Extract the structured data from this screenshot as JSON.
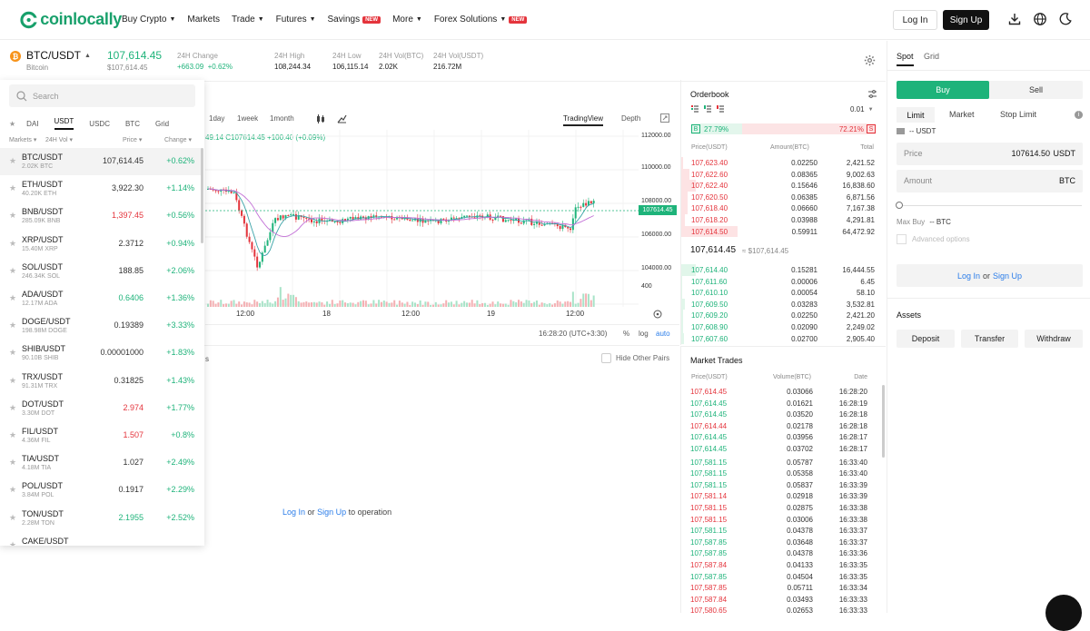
{
  "header": {
    "logo_text": "coinlocally",
    "nav": [
      {
        "label": "Buy Crypto",
        "caret": true,
        "badge": ""
      },
      {
        "label": "Markets",
        "caret": false,
        "badge": ""
      },
      {
        "label": "Trade",
        "caret": true,
        "badge": ""
      },
      {
        "label": "Futures",
        "caret": true,
        "badge": ""
      },
      {
        "label": "Savings",
        "caret": false,
        "badge": "NEW"
      },
      {
        "label": "More",
        "caret": true,
        "badge": ""
      },
      {
        "label": "Forex Solutions",
        "caret": true,
        "badge": "NEW"
      }
    ],
    "login": "Log In",
    "signup": "Sign Up"
  },
  "ticker": {
    "pair": "BTC/USDT",
    "name": "Bitcoin",
    "last_price": "107,614.45",
    "last_price_usd": "$107,614.45",
    "change_label": "24H Change",
    "change_abs": "+663.09",
    "change_pct": "+0.62%",
    "high_label": "24H High",
    "high": "108,244.34",
    "low_label": "24H Low",
    "low": "106,115.14",
    "volbtc_label": "24H Vol(BTC)",
    "volbtc": "2.02K",
    "volusdt_label": "24H Vol(USDT)",
    "volusdt": "216.72M"
  },
  "markets": {
    "search_placeholder": "Search",
    "quote_tabs": [
      "DAI",
      "USDT",
      "USDC",
      "BTC",
      "Grid"
    ],
    "active_tab": "USDT",
    "col_markets": "Markets",
    "col_vol": "24H Vol",
    "col_price": "Price",
    "col_change": "Change",
    "rows": [
      {
        "pair": "BTC/USDT",
        "vol": "2.02K BTC",
        "price": "107,614.45",
        "change": "+0.62%",
        "price_color": "neutral"
      },
      {
        "pair": "ETH/USDT",
        "vol": "40.20K ETH",
        "price": "3,922.30",
        "change": "+1.14%",
        "price_color": "neutral"
      },
      {
        "pair": "BNB/USDT",
        "vol": "285.09K BNB",
        "price": "1,397.45",
        "change": "+0.56%",
        "price_color": "red"
      },
      {
        "pair": "XRP/USDT",
        "vol": "15.40M XRP",
        "price": "2.3712",
        "change": "+0.94%",
        "price_color": "neutral"
      },
      {
        "pair": "SOL/USDT",
        "vol": "246.34K SOL",
        "price": "188.85",
        "change": "+2.06%",
        "price_color": "neutral"
      },
      {
        "pair": "ADA/USDT",
        "vol": "12.17M ADA",
        "price": "0.6406",
        "change": "+1.36%",
        "price_color": "green"
      },
      {
        "pair": "DOGE/USDT",
        "vol": "198.98M DOGE",
        "price": "0.19389",
        "change": "+3.33%",
        "price_color": "neutral"
      },
      {
        "pair": "SHIB/USDT",
        "vol": "90.10B SHIB",
        "price": "0.00001000",
        "change": "+1.83%",
        "price_color": "neutral"
      },
      {
        "pair": "TRX/USDT",
        "vol": "91.31M TRX",
        "price": "0.31825",
        "change": "+1.43%",
        "price_color": "neutral"
      },
      {
        "pair": "DOT/USDT",
        "vol": "3.30M DOT",
        "price": "2.974",
        "change": "+1.77%",
        "price_color": "red"
      },
      {
        "pair": "FIL/USDT",
        "vol": "4.36M FIL",
        "price": "1.507",
        "change": "+0.8%",
        "price_color": "red"
      },
      {
        "pair": "TIA/USDT",
        "vol": "4.18M TIA",
        "price": "1.027",
        "change": "+2.49%",
        "price_color": "neutral"
      },
      {
        "pair": "POL/USDT",
        "vol": "3.84M POL",
        "price": "0.1917",
        "change": "+2.29%",
        "price_color": "neutral"
      },
      {
        "pair": "TON/USDT",
        "vol": "2.28M TON",
        "price": "2.1955",
        "change": "+2.52%",
        "price_color": "green"
      },
      {
        "pair": "CAKE/USDT",
        "vol": "",
        "price": "",
        "change": "",
        "price_color": "neutral"
      }
    ]
  },
  "chart": {
    "intervals": [
      "1day",
      "1week",
      "1month"
    ],
    "view_tabs": [
      "TradingView",
      "Depth"
    ],
    "ohlc_text": "49.14 C107614.45 +100.40 (+0.09%)",
    "price_tag": "107614.45",
    "y_ticks": [
      "112000.00",
      "110000.00",
      "108000.00",
      "106000.00",
      "104000.00",
      "400"
    ],
    "x_ticks": [
      "12:00",
      "18",
      "12:00",
      "19",
      "12:00"
    ],
    "time_display": "16:28:20 (UTC+3:30)",
    "scale_percent": "%",
    "scale_log": "log",
    "scale_auto": "auto",
    "hide_other_pairs": "Hide Other Pairs",
    "login_prompt_login": "Log In",
    "login_prompt_or": "or",
    "login_prompt_signup": "Sign Up",
    "login_prompt_rest": "to operation",
    "truncated_tab_tail": "s"
  },
  "orderbook": {
    "title": "Orderbook",
    "precision": "0.01",
    "buy_pct": "27.79%",
    "sell_pct": "72.21%",
    "buy_letter": "B",
    "sell_letter": "S",
    "col_price": "Price(USDT)",
    "col_amount": "Amount(BTC)",
    "col_total": "Total",
    "asks": [
      {
        "price": "107,623.40",
        "amount": "0.02250",
        "total": "2,421.52",
        "depth": 0.04
      },
      {
        "price": "107,622.60",
        "amount": "0.08365",
        "total": "9,002.63",
        "depth": 0.14
      },
      {
        "price": "107,622.40",
        "amount": "0.15646",
        "total": "16,838.60",
        "depth": 0.26
      },
      {
        "price": "107,620.50",
        "amount": "0.06385",
        "total": "6,871.56",
        "depth": 0.11
      },
      {
        "price": "107,618.40",
        "amount": "0.06660",
        "total": "7,167.38",
        "depth": 0.11
      },
      {
        "price": "107,618.20",
        "amount": "0.03988",
        "total": "4,291.81",
        "depth": 0.07
      },
      {
        "price": "107,614.50",
        "amount": "0.59911",
        "total": "64,472.92",
        "depth": 1.0
      }
    ],
    "mid_price": "107,614.45",
    "mid_usd": "≈ $107,614.45",
    "bids": [
      {
        "price": "107,614.40",
        "amount": "0.15281",
        "total": "16,444.55",
        "depth": 0.26
      },
      {
        "price": "107,611.60",
        "amount": "0.00006",
        "total": "6.45",
        "depth": 0.01
      },
      {
        "price": "107,610.10",
        "amount": "0.00054",
        "total": "58.10",
        "depth": 0.01
      },
      {
        "price": "107,609.50",
        "amount": "0.03283",
        "total": "3,532.81",
        "depth": 0.06
      },
      {
        "price": "107,609.20",
        "amount": "0.02250",
        "total": "2,421.20",
        "depth": 0.04
      },
      {
        "price": "107,608.90",
        "amount": "0.02090",
        "total": "2,249.02",
        "depth": 0.04
      },
      {
        "price": "107,607.60",
        "amount": "0.02700",
        "total": "2,905.40",
        "depth": 0.05
      }
    ]
  },
  "trades": {
    "title": "Market Trades",
    "col_price": "Price(USDT)",
    "col_volume": "Volume(BTC)",
    "col_date": "Date",
    "rows": [
      {
        "price": "107,614.45",
        "volume": "0.03066",
        "date": "16:28:20",
        "side": "sell"
      },
      {
        "price": "107,614.45",
        "volume": "0.01621",
        "date": "16:28:19",
        "side": "buy"
      },
      {
        "price": "107,614.45",
        "volume": "0.03520",
        "date": "16:28:18",
        "side": "buy"
      },
      {
        "price": "107,614.44",
        "volume": "0.02178",
        "date": "16:28:18",
        "side": "sell"
      },
      {
        "price": "107,614.45",
        "volume": "0.03956",
        "date": "16:28:17",
        "side": "buy"
      },
      {
        "price": "107,614.45",
        "volume": "0.03702",
        "date": "16:28:17",
        "side": "buy"
      },
      {
        "price": "107,581.15",
        "volume": "0.05787",
        "date": "16:33:40",
        "side": "buy"
      },
      {
        "price": "107,581.15",
        "volume": "0.05358",
        "date": "16:33:40",
        "side": "buy"
      },
      {
        "price": "107,581.15",
        "volume": "0.05837",
        "date": "16:33:39",
        "side": "buy"
      },
      {
        "price": "107,581.14",
        "volume": "0.02918",
        "date": "16:33:39",
        "side": "sell"
      },
      {
        "price": "107,581.15",
        "volume": "0.02875",
        "date": "16:33:38",
        "side": "sell"
      },
      {
        "price": "107,581.15",
        "volume": "0.03006",
        "date": "16:33:38",
        "side": "sell"
      },
      {
        "price": "107,581.15",
        "volume": "0.04378",
        "date": "16:33:37",
        "side": "buy"
      },
      {
        "price": "107,587.85",
        "volume": "0.03648",
        "date": "16:33:37",
        "side": "buy"
      },
      {
        "price": "107,587.85",
        "volume": "0.04378",
        "date": "16:33:36",
        "side": "buy"
      },
      {
        "price": "107,587.84",
        "volume": "0.04133",
        "date": "16:33:35",
        "side": "sell"
      },
      {
        "price": "107,587.85",
        "volume": "0.04504",
        "date": "16:33:35",
        "side": "buy"
      },
      {
        "price": "107,587.85",
        "volume": "0.05711",
        "date": "16:33:34",
        "side": "sell"
      },
      {
        "price": "107,587.84",
        "volume": "0.03493",
        "date": "16:33:33",
        "side": "sell"
      },
      {
        "price": "107,580.65",
        "volume": "0.02653",
        "date": "16:33:33",
        "side": "sell"
      }
    ]
  },
  "trade_panel": {
    "tabs": [
      "Spot",
      "Grid"
    ],
    "buy": "Buy",
    "sell": "Sell",
    "order_types": [
      "Limit",
      "Market",
      "Stop Limit"
    ],
    "avail": "-- USDT",
    "price_label": "Price",
    "price_value": "107614.50",
    "price_unit": "USDT",
    "amount_label": "Amount",
    "amount_unit": "BTC",
    "maxbuy_label": "Max Buy",
    "maxbuy_value": "-- BTC",
    "advanced": "Advanced options",
    "login": "Log In",
    "or": "or",
    "signup": "Sign Up",
    "assets_title": "Assets",
    "deposit": "Deposit",
    "transfer": "Transfer",
    "withdraw": "Withdraw"
  },
  "colors": {
    "green": "#1eb37a",
    "red": "#e4343c",
    "brand": "#18a06b"
  }
}
